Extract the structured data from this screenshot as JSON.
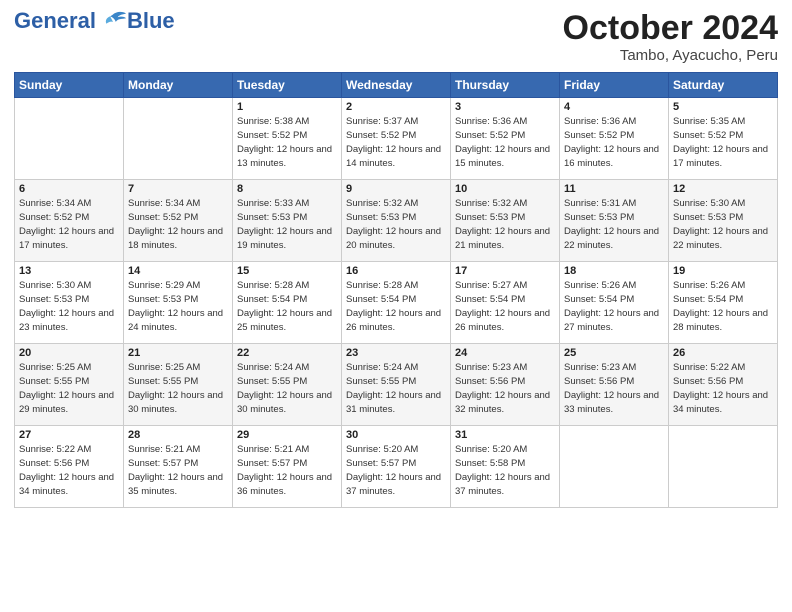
{
  "logo": {
    "text_general": "General",
    "text_blue": "Blue"
  },
  "header": {
    "title": "October 2024",
    "subtitle": "Tambo, Ayacucho, Peru"
  },
  "weekdays": [
    "Sunday",
    "Monday",
    "Tuesday",
    "Wednesday",
    "Thursday",
    "Friday",
    "Saturday"
  ],
  "weeks": [
    [
      {
        "day": "",
        "sunrise": "",
        "sunset": "",
        "daylight": ""
      },
      {
        "day": "",
        "sunrise": "",
        "sunset": "",
        "daylight": ""
      },
      {
        "day": "1",
        "sunrise": "Sunrise: 5:38 AM",
        "sunset": "Sunset: 5:52 PM",
        "daylight": "Daylight: 12 hours and 13 minutes."
      },
      {
        "day": "2",
        "sunrise": "Sunrise: 5:37 AM",
        "sunset": "Sunset: 5:52 PM",
        "daylight": "Daylight: 12 hours and 14 minutes."
      },
      {
        "day": "3",
        "sunrise": "Sunrise: 5:36 AM",
        "sunset": "Sunset: 5:52 PM",
        "daylight": "Daylight: 12 hours and 15 minutes."
      },
      {
        "day": "4",
        "sunrise": "Sunrise: 5:36 AM",
        "sunset": "Sunset: 5:52 PM",
        "daylight": "Daylight: 12 hours and 16 minutes."
      },
      {
        "day": "5",
        "sunrise": "Sunrise: 5:35 AM",
        "sunset": "Sunset: 5:52 PM",
        "daylight": "Daylight: 12 hours and 17 minutes."
      }
    ],
    [
      {
        "day": "6",
        "sunrise": "Sunrise: 5:34 AM",
        "sunset": "Sunset: 5:52 PM",
        "daylight": "Daylight: 12 hours and 17 minutes."
      },
      {
        "day": "7",
        "sunrise": "Sunrise: 5:34 AM",
        "sunset": "Sunset: 5:52 PM",
        "daylight": "Daylight: 12 hours and 18 minutes."
      },
      {
        "day": "8",
        "sunrise": "Sunrise: 5:33 AM",
        "sunset": "Sunset: 5:53 PM",
        "daylight": "Daylight: 12 hours and 19 minutes."
      },
      {
        "day": "9",
        "sunrise": "Sunrise: 5:32 AM",
        "sunset": "Sunset: 5:53 PM",
        "daylight": "Daylight: 12 hours and 20 minutes."
      },
      {
        "day": "10",
        "sunrise": "Sunrise: 5:32 AM",
        "sunset": "Sunset: 5:53 PM",
        "daylight": "Daylight: 12 hours and 21 minutes."
      },
      {
        "day": "11",
        "sunrise": "Sunrise: 5:31 AM",
        "sunset": "Sunset: 5:53 PM",
        "daylight": "Daylight: 12 hours and 22 minutes."
      },
      {
        "day": "12",
        "sunrise": "Sunrise: 5:30 AM",
        "sunset": "Sunset: 5:53 PM",
        "daylight": "Daylight: 12 hours and 22 minutes."
      }
    ],
    [
      {
        "day": "13",
        "sunrise": "Sunrise: 5:30 AM",
        "sunset": "Sunset: 5:53 PM",
        "daylight": "Daylight: 12 hours and 23 minutes."
      },
      {
        "day": "14",
        "sunrise": "Sunrise: 5:29 AM",
        "sunset": "Sunset: 5:53 PM",
        "daylight": "Daylight: 12 hours and 24 minutes."
      },
      {
        "day": "15",
        "sunrise": "Sunrise: 5:28 AM",
        "sunset": "Sunset: 5:54 PM",
        "daylight": "Daylight: 12 hours and 25 minutes."
      },
      {
        "day": "16",
        "sunrise": "Sunrise: 5:28 AM",
        "sunset": "Sunset: 5:54 PM",
        "daylight": "Daylight: 12 hours and 26 minutes."
      },
      {
        "day": "17",
        "sunrise": "Sunrise: 5:27 AM",
        "sunset": "Sunset: 5:54 PM",
        "daylight": "Daylight: 12 hours and 26 minutes."
      },
      {
        "day": "18",
        "sunrise": "Sunrise: 5:26 AM",
        "sunset": "Sunset: 5:54 PM",
        "daylight": "Daylight: 12 hours and 27 minutes."
      },
      {
        "day": "19",
        "sunrise": "Sunrise: 5:26 AM",
        "sunset": "Sunset: 5:54 PM",
        "daylight": "Daylight: 12 hours and 28 minutes."
      }
    ],
    [
      {
        "day": "20",
        "sunrise": "Sunrise: 5:25 AM",
        "sunset": "Sunset: 5:55 PM",
        "daylight": "Daylight: 12 hours and 29 minutes."
      },
      {
        "day": "21",
        "sunrise": "Sunrise: 5:25 AM",
        "sunset": "Sunset: 5:55 PM",
        "daylight": "Daylight: 12 hours and 30 minutes."
      },
      {
        "day": "22",
        "sunrise": "Sunrise: 5:24 AM",
        "sunset": "Sunset: 5:55 PM",
        "daylight": "Daylight: 12 hours and 30 minutes."
      },
      {
        "day": "23",
        "sunrise": "Sunrise: 5:24 AM",
        "sunset": "Sunset: 5:55 PM",
        "daylight": "Daylight: 12 hours and 31 minutes."
      },
      {
        "day": "24",
        "sunrise": "Sunrise: 5:23 AM",
        "sunset": "Sunset: 5:56 PM",
        "daylight": "Daylight: 12 hours and 32 minutes."
      },
      {
        "day": "25",
        "sunrise": "Sunrise: 5:23 AM",
        "sunset": "Sunset: 5:56 PM",
        "daylight": "Daylight: 12 hours and 33 minutes."
      },
      {
        "day": "26",
        "sunrise": "Sunrise: 5:22 AM",
        "sunset": "Sunset: 5:56 PM",
        "daylight": "Daylight: 12 hours and 34 minutes."
      }
    ],
    [
      {
        "day": "27",
        "sunrise": "Sunrise: 5:22 AM",
        "sunset": "Sunset: 5:56 PM",
        "daylight": "Daylight: 12 hours and 34 minutes."
      },
      {
        "day": "28",
        "sunrise": "Sunrise: 5:21 AM",
        "sunset": "Sunset: 5:57 PM",
        "daylight": "Daylight: 12 hours and 35 minutes."
      },
      {
        "day": "29",
        "sunrise": "Sunrise: 5:21 AM",
        "sunset": "Sunset: 5:57 PM",
        "daylight": "Daylight: 12 hours and 36 minutes."
      },
      {
        "day": "30",
        "sunrise": "Sunrise: 5:20 AM",
        "sunset": "Sunset: 5:57 PM",
        "daylight": "Daylight: 12 hours and 37 minutes."
      },
      {
        "day": "31",
        "sunrise": "Sunrise: 5:20 AM",
        "sunset": "Sunset: 5:58 PM",
        "daylight": "Daylight: 12 hours and 37 minutes."
      },
      {
        "day": "",
        "sunrise": "",
        "sunset": "",
        "daylight": ""
      },
      {
        "day": "",
        "sunrise": "",
        "sunset": "",
        "daylight": ""
      }
    ]
  ]
}
